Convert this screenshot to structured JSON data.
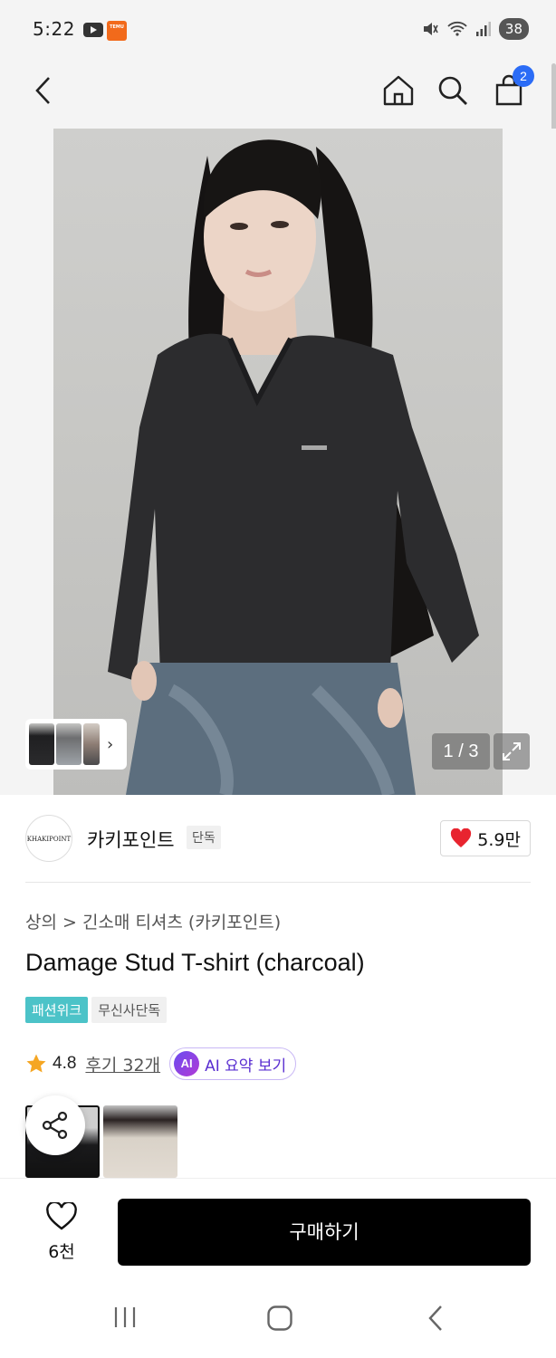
{
  "status_bar": {
    "time": "5:22",
    "battery": "38",
    "temu_label": "TEMU"
  },
  "top_nav": {
    "cart_count": "2"
  },
  "gallery": {
    "counter": "1 / 3"
  },
  "brand": {
    "logo_text": "KHAKIPOINT",
    "name": "카키포인트",
    "tag": "단독",
    "like_count": "5.9만"
  },
  "product": {
    "breadcrumb": "상의 > 긴소매 티셔츠 (카키포인트)",
    "title": "Damage Stud T-shirt (charcoal)",
    "badges": [
      "패션위크",
      "무신사단독"
    ],
    "rating": "4.8",
    "reviews": "후기 32개",
    "ai_badge": "AI",
    "ai_label": "AI 요약 보기"
  },
  "bottom_bar": {
    "wish_count": "6천",
    "buy_label": "구매하기"
  },
  "colors": {
    "accent_blue": "#2b6cf6",
    "badge_teal": "#4cc3c8",
    "ai_purple": "#5a2fd1",
    "heart_red": "#e8242f",
    "star_orange": "#f5a623"
  }
}
